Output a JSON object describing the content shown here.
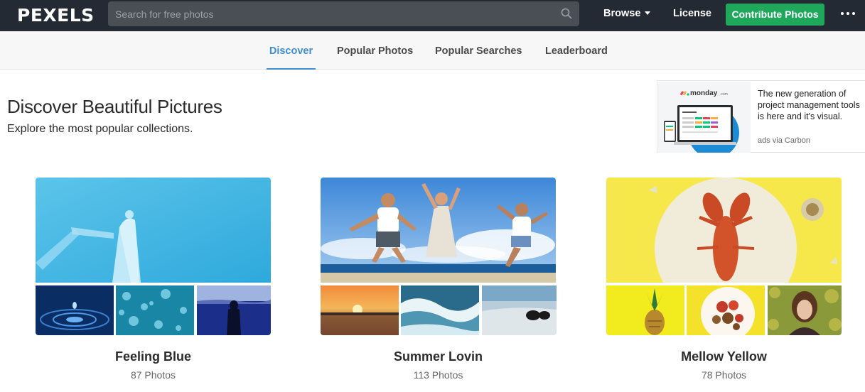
{
  "header": {
    "logo": "PEXELS",
    "search_placeholder": "Search for free photos",
    "browse_label": "Browse",
    "license_label": "License",
    "contribute_label": "Contribute Photos",
    "accent_color": "#1fa85c"
  },
  "subnav": {
    "tabs": [
      {
        "label": "Discover",
        "active": true
      },
      {
        "label": "Popular Photos",
        "active": false
      },
      {
        "label": "Popular Searches",
        "active": false
      },
      {
        "label": "Leaderboard",
        "active": false
      }
    ],
    "active_color": "#3e8ed0"
  },
  "hero": {
    "title": "Discover Beautiful Pictures",
    "subtitle": "Explore the most popular collections."
  },
  "ad": {
    "brand": "monday",
    "brand_suffix": ".com",
    "text": "The new generation of project management tools is here and it's visual.",
    "via": "ads via Carbon"
  },
  "collections": [
    {
      "title": "Feeling Blue",
      "count": "87 Photos"
    },
    {
      "title": "Summer Lovin",
      "count": "113 Photos"
    },
    {
      "title": "Mellow Yellow",
      "count": "78 Photos"
    }
  ]
}
